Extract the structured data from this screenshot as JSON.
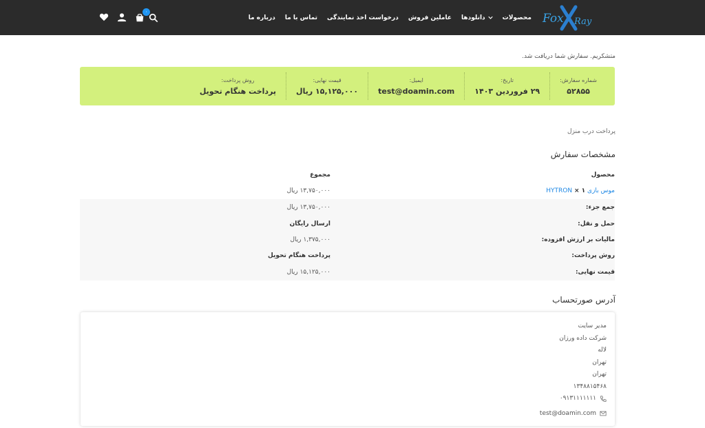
{
  "brand": {
    "logo_text": "FoxXRay",
    "accent": "#2196f3"
  },
  "header": {
    "nav": [
      {
        "label": "محصولات"
      },
      {
        "label": "دانلودها",
        "has_dropdown": true
      },
      {
        "label": "عاملین فروش"
      },
      {
        "label": "درخواست اخذ نمایندگی"
      },
      {
        "label": "تماس با ما"
      },
      {
        "label": "درباره ما"
      }
    ],
    "cart_count": "۰",
    "icons": [
      "search-icon",
      "cart-icon",
      "user-icon",
      "heart-icon"
    ]
  },
  "thanks_message": "متشکریم. سفارش شما دریافت شد.",
  "summary": {
    "background": "#d3f07d",
    "items": [
      {
        "label": "شماره سفارش:",
        "value": "۵۲۸۵۵"
      },
      {
        "label": "تاریخ:",
        "value": "۲۹ فروردین ۱۴۰۳"
      },
      {
        "label": "ایمیل:",
        "value": "test@doamin.com"
      },
      {
        "label": "قیمت نهایی:",
        "value": "۱۵,۱۲۵,۰۰۰ ریال"
      },
      {
        "label": "روش پرداخت:",
        "value": "پرداخت هنگام تحویل"
      }
    ]
  },
  "payment_note": "پرداخت درب منزل",
  "order_details": {
    "title": "مشخصات سفارش",
    "col_product": "محصول",
    "col_total": "مجموع",
    "item": {
      "name": "موس بازی HYTRON",
      "qty": "× ۱",
      "total": "۱۳,۷۵۰,۰۰۰ ریال"
    },
    "rows": [
      {
        "label": "جمع جزء:",
        "value": "۱۳,۷۵۰,۰۰۰ ریال",
        "value_bold": false
      },
      {
        "label": "حمل و نقل:",
        "value": "ارسال رایگان",
        "value_bold": true
      },
      {
        "label": "مالیات بر ارزش افزوده:",
        "value": "۱,۳۷۵,۰۰۰ ریال",
        "value_bold": false
      },
      {
        "label": "روش پرداخت:",
        "value": "پرداخت هنگام تحویل",
        "value_bold": true
      },
      {
        "label": "قیمت نهایی:",
        "value": "۱۵,۱۲۵,۰۰۰ ریال",
        "value_bold": false
      }
    ]
  },
  "billing": {
    "title": "آدرس صورتحساب",
    "lines": [
      "مدیر سایت",
      "شرکت داده ورزان",
      "لاله",
      "تهران",
      "تهران",
      "۱۳۴۸۸۱۵۴۶۸"
    ],
    "phone": "۰۹۱۳۱۱۱۱۱۱۱",
    "email": "test@doamin.com"
  }
}
